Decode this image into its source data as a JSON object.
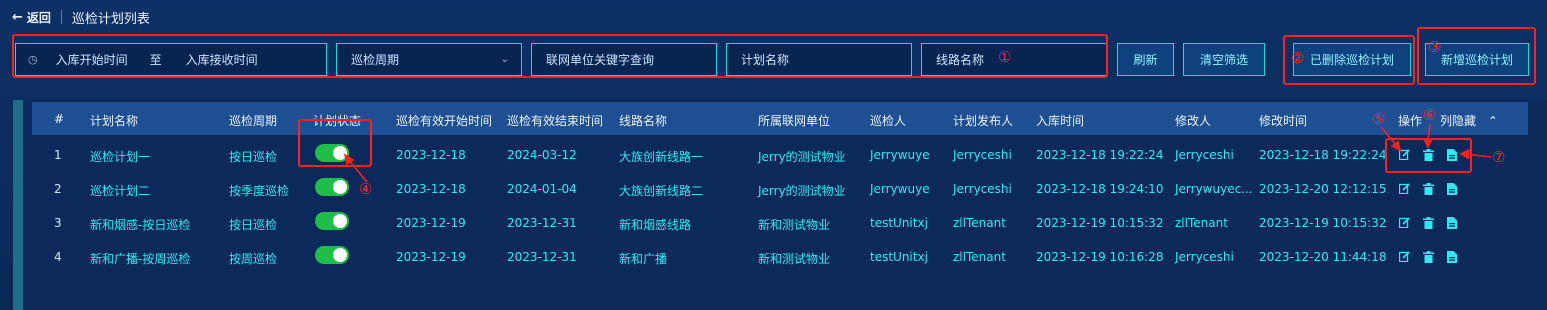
{
  "header": {
    "back_label": "返回",
    "title": "巡检计划列表"
  },
  "filters": {
    "date_start_placeholder": "入库开始时间",
    "date_separator": "至",
    "date_end_placeholder": "入库接收时间",
    "cycle_placeholder": "巡检周期",
    "unit_placeholder": "联网单位关键字查询",
    "plan_name_placeholder": "计划名称",
    "line_name_placeholder": "线路名称"
  },
  "buttons": {
    "refresh": "刷新",
    "clear": "清空筛选",
    "deleted": "已删除巡检计划",
    "add": "新增巡检计划"
  },
  "annotations": [
    "①",
    "②",
    "③",
    "④",
    "⑤",
    "⑥",
    "⑦"
  ],
  "table": {
    "columns": [
      "#",
      "计划名称",
      "巡检周期",
      "计划状态",
      "巡检有效开始时间",
      "巡检有效结束时间",
      "线路名称",
      "所属联网单位",
      "巡检人",
      "计划发布人",
      "入库时间",
      "修改人",
      "修改时间",
      "操作",
      "列隐藏"
    ],
    "column_toggle_icon": "chevron-up-icon",
    "rows": [
      {
        "idx": "1",
        "name": "巡检计划一",
        "cycle": "按日巡检",
        "enabled": true,
        "start": "2023-12-18",
        "end": "2024-03-12",
        "line": "大族创新线路一",
        "unit": "Jerry的测试物业",
        "inspector": "Jerrywuye",
        "publisher": "Jerryceshi",
        "created": "2023-12-18 19:22:24",
        "modifier": "Jerryceshi",
        "modified": "2023-12-18 19:22:24"
      },
      {
        "idx": "2",
        "name": "巡检计划二",
        "cycle": "按季度巡检",
        "enabled": true,
        "start": "2023-12-18",
        "end": "2024-01-04",
        "line": "大族创新线路二",
        "unit": "Jerry的测试物业",
        "inspector": "Jerrywuye",
        "publisher": "Jerryceshi",
        "created": "2023-12-18 19:24:10",
        "modifier": "Jerrywuyec...",
        "modified": "2023-12-20 12:12:15"
      },
      {
        "idx": "3",
        "name": "新和烟感-按日巡检",
        "cycle": "按日巡检",
        "enabled": true,
        "start": "2023-12-19",
        "end": "2023-12-31",
        "line": "新和烟感线路",
        "unit": "新和测试物业",
        "inspector": "testUnitxj",
        "publisher": "zllTenant",
        "created": "2023-12-19 10:15:32",
        "modifier": "zllTenant",
        "modified": "2023-12-19 10:15:32"
      },
      {
        "idx": "4",
        "name": "新和广播-按周巡检",
        "cycle": "按周巡检",
        "enabled": true,
        "start": "2023-12-19",
        "end": "2023-12-31",
        "line": "新和广播",
        "unit": "新和测试物业",
        "inspector": "testUnitxj",
        "publisher": "zllTenant",
        "created": "2023-12-19 10:16:28",
        "modifier": "Jerryceshi",
        "modified": "2023-12-20 11:44:18"
      }
    ]
  },
  "colors": {
    "accent_cyan": "#21d6d6",
    "text_cyan": "#2ee9f0",
    "toggle_on": "#1fbf47",
    "annotation_red": "#ff1f1f",
    "header_bg": "#1e4f93"
  }
}
